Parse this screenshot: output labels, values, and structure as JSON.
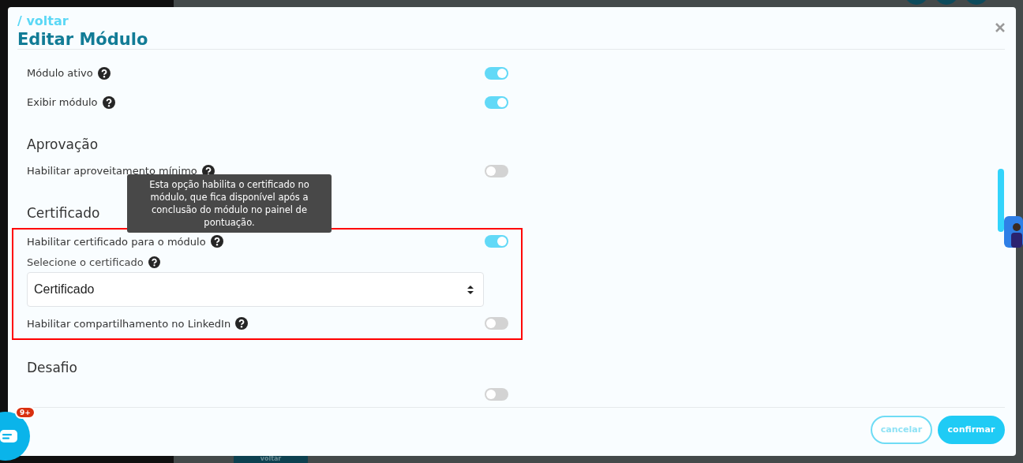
{
  "header": {
    "back_link": "/ voltar",
    "title": "Editar Módulo"
  },
  "sections": [
    {
      "highlighted": false,
      "rows": [
        {
          "kind": "toggle",
          "label": "Módulo ativo",
          "on": true
        },
        {
          "kind": "toggle",
          "label": "Exibir módulo",
          "on": true
        }
      ]
    },
    {
      "heading": "Aprovação",
      "highlighted": false,
      "rows": [
        {
          "kind": "toggle",
          "label": "Habilitar aproveitamento mínimo",
          "on": false
        }
      ]
    },
    {
      "heading": "Certificado",
      "highlighted": true,
      "rows": [
        {
          "kind": "toggle",
          "label": "Habilitar certificado para o módulo",
          "on": true,
          "tooltip": "Esta opção habilita o certificado no módulo, que fica disponível após a conclusão do módulo no painel de pontuação."
        },
        {
          "kind": "select",
          "label": "Selecione o certificado",
          "value": "Certificado"
        },
        {
          "kind": "toggle",
          "label": "Habilitar compartilhamento no LinkedIn",
          "on": false
        }
      ]
    },
    {
      "heading": "Desafio",
      "highlighted": false,
      "rows": [
        {
          "kind": "toggle",
          "on": false
        }
      ]
    }
  ],
  "footer": {
    "buttons": [
      {
        "label": "cancelar",
        "kind": "secondary"
      },
      {
        "label": "confirmar",
        "kind": "primary"
      }
    ]
  },
  "chat_badge": "9+",
  "background_button": "voltar"
}
